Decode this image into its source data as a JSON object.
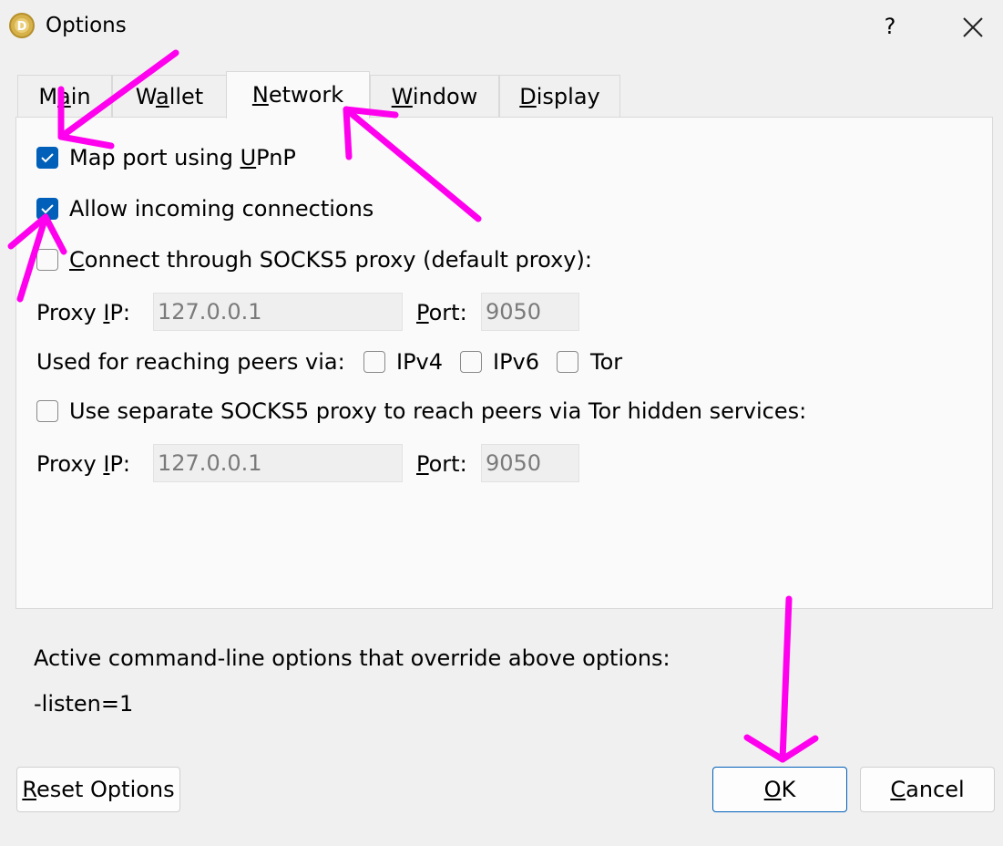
{
  "window": {
    "title": "Options",
    "help_glyph": "?",
    "app_icon": "dogecoin-coin-icon",
    "close_icon": "close-icon"
  },
  "tabs": [
    {
      "pre": "M",
      "mnemonic": "a",
      "post": "in",
      "active": false
    },
    {
      "pre": "W",
      "mnemonic": "a",
      "post": "llet",
      "active": false
    },
    {
      "pre": "",
      "mnemonic": "N",
      "post": "etwork",
      "active": true
    },
    {
      "pre": "",
      "mnemonic": "W",
      "post": "indow",
      "active": false
    },
    {
      "pre": "",
      "mnemonic": "D",
      "post": "isplay",
      "active": false
    }
  ],
  "network": {
    "upnp": {
      "pre": "Map port using ",
      "mnemonic": "U",
      "post": "PnP",
      "checked": true
    },
    "incoming": {
      "label": "Allow incoming connections",
      "checked": true
    },
    "socks5": {
      "pre": "",
      "mnemonic": "C",
      "post": "onnect through SOCKS5 proxy (default proxy):",
      "checked": false
    },
    "proxy1": {
      "ip_label_pre": "Proxy ",
      "ip_label_mnemonic": "I",
      "ip_label_post": "P:",
      "ip_value": "127.0.0.1",
      "port_label_pre": "",
      "port_label_mnemonic": "P",
      "port_label_post": "ort:",
      "port_value": "9050"
    },
    "reach_label": "Used for reaching peers via:",
    "reach": [
      {
        "label": "IPv4",
        "checked": false
      },
      {
        "label": "IPv6",
        "checked": false
      },
      {
        "label": "Tor",
        "checked": false
      }
    ],
    "tor_separate": {
      "label": "Use separate SOCKS5 proxy to reach peers via Tor hidden services:",
      "checked": false
    },
    "proxy2": {
      "ip_label_pre": "Proxy ",
      "ip_label_mnemonic": "I",
      "ip_label_post": "P:",
      "ip_value": "127.0.0.1",
      "port_label_pre": "",
      "port_label_mnemonic": "P",
      "port_label_post": "ort:",
      "port_value": "9050"
    }
  },
  "overrides": {
    "label": "Active command-line options that override above options:",
    "value": "-listen=1"
  },
  "buttons": {
    "reset": {
      "pre": "",
      "mnemonic": "R",
      "post": "eset Options"
    },
    "ok": {
      "pre": "",
      "mnemonic": "O",
      "post": "K"
    },
    "cancel": {
      "pre": "",
      "mnemonic": "C",
      "post": "ancel"
    }
  },
  "annotation_color": "#ff00ee"
}
